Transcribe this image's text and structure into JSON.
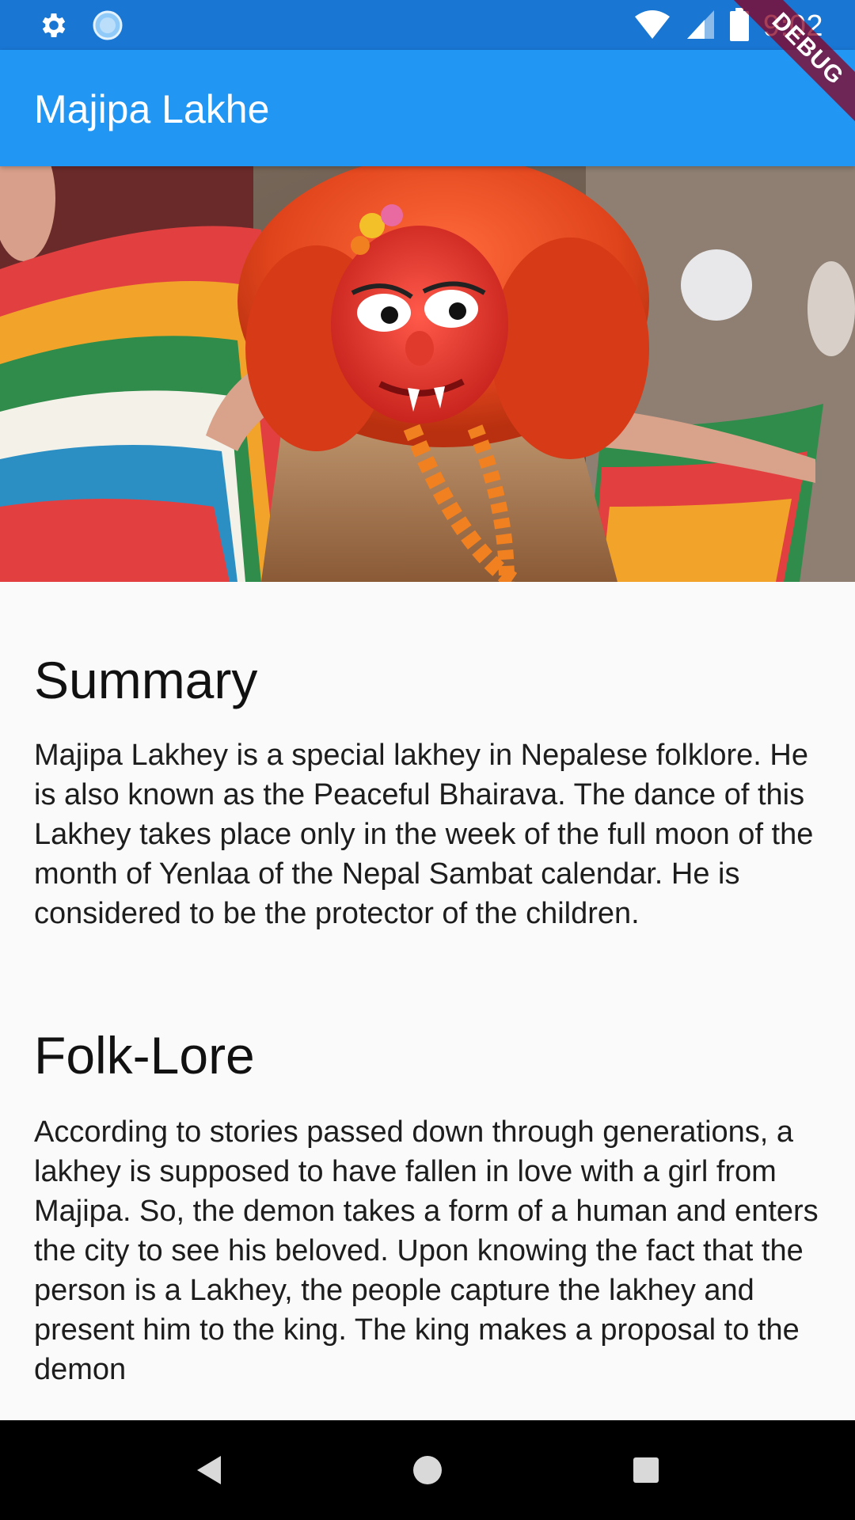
{
  "status_bar": {
    "time": "9:02",
    "icons": [
      "settings-icon",
      "sync-icon",
      "wifi-icon",
      "signal-icon",
      "battery-icon"
    ]
  },
  "app_bar": {
    "title": "Majipa Lakhe"
  },
  "debug_banner": {
    "label": "DEBUG"
  },
  "hero": {
    "description_icon": "image"
  },
  "sections": {
    "summary": {
      "title": "Summary",
      "body": "Majipa Lakhey is a special lakhey in Nepalese folklore. He is also known as the Peaceful Bhairava. The dance of this Lakhey takes place only in the week of the full moon of the month of Yenlaa of the Nepal Sambat calendar. He is considered to be the protector of the children."
    },
    "folklore": {
      "title": "Folk-Lore",
      "body": "According to stories passed down through generations, a lakhey is supposed to have fallen in love with a girl from Majipa. So, the demon takes a form of a human and enters the city to see his beloved. Upon knowing the fact that the person is a Lakhey, the people capture the lakhey and present him to the king. The king makes a proposal to the demon"
    }
  },
  "nav_bar": {
    "buttons": [
      "back-icon",
      "home-icon",
      "recents-icon"
    ]
  },
  "colors": {
    "status_bar": "#1976d2",
    "app_bar": "#2196f3",
    "background": "#fafafa",
    "nav_bar": "#000000"
  }
}
